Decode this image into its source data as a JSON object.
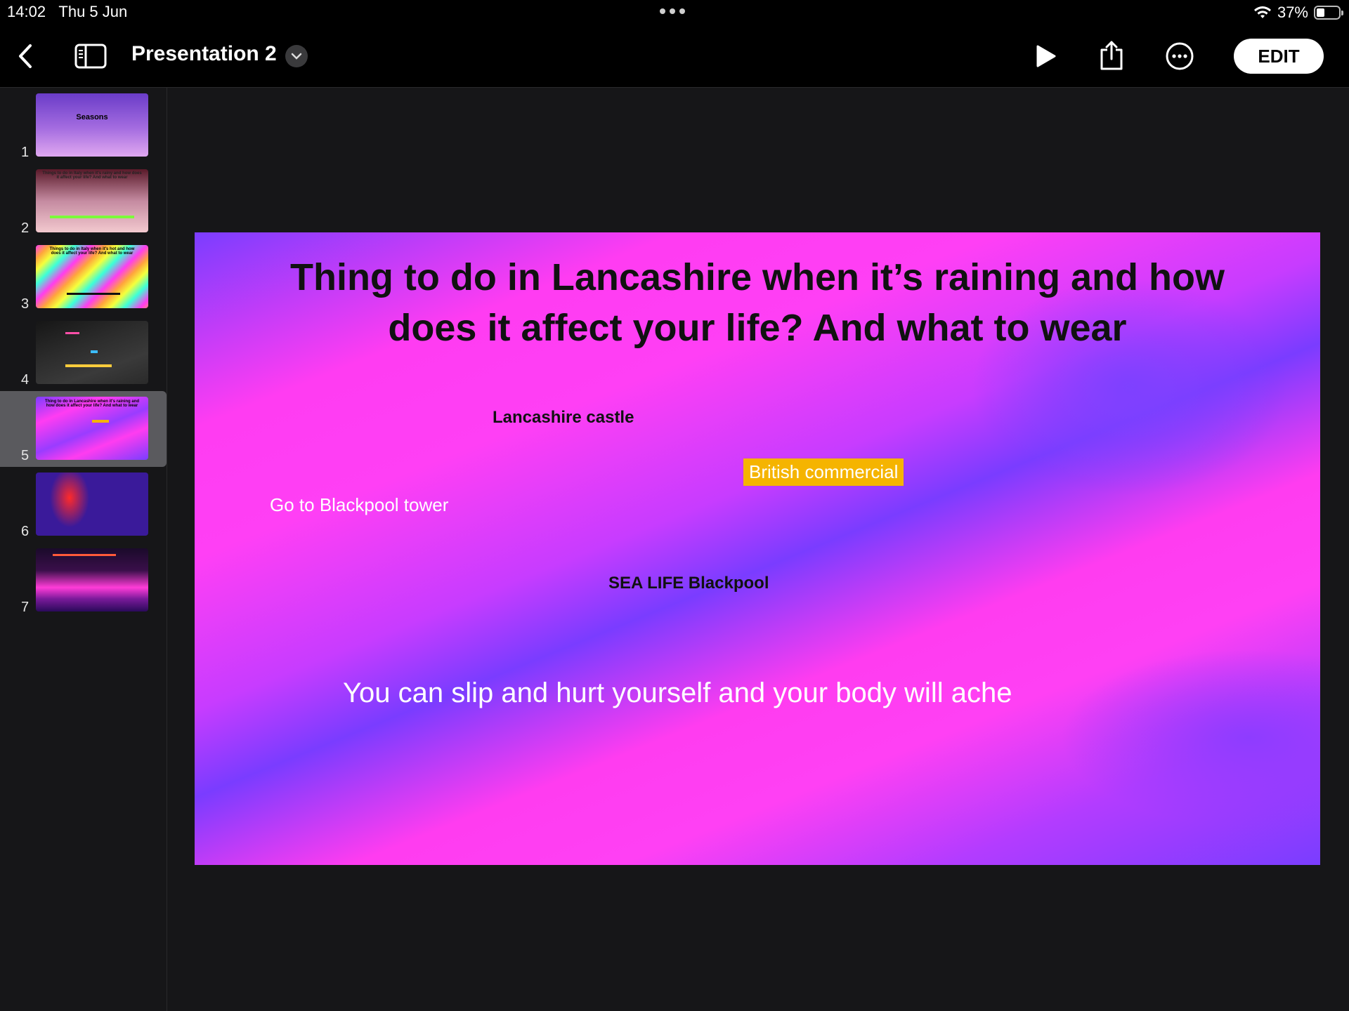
{
  "status_bar": {
    "time": "14:02",
    "date": "Thu 5 Jun",
    "battery": "37%",
    "battery_level": 0.37
  },
  "toolbar": {
    "title": "Presentation 2",
    "edit_label": "EDIT"
  },
  "icons": {
    "back": "chevron-left-icon",
    "sidebar": "sidebar-icon",
    "play": "play-icon",
    "share": "share-icon",
    "more": "more-icon"
  },
  "thumbnails": [
    {
      "num": "1",
      "caption": "Seasons"
    },
    {
      "num": "2",
      "caption": "Things to do in Italy when it's rainy and how does it affect your life? And what to wear"
    },
    {
      "num": "3",
      "caption": "Things to do in Italy when it's hot and how does it affect your life? And what to wear"
    },
    {
      "num": "4",
      "caption": ""
    },
    {
      "num": "5",
      "caption": "Thing to do in Lancashire when it's raining and how does it affect your life? And what to wear"
    },
    {
      "num": "6",
      "caption": ""
    },
    {
      "num": "7",
      "caption": ""
    }
  ],
  "slide": {
    "title": "Thing to do in  Lancashire when it’s raining and how does it affect your life? And what to wear",
    "lancashire": "Lancashire castle",
    "british": "British commercial",
    "blackpool_tower": "Go to Blackpool tower",
    "sea_life": "SEA LIFE Blackpool",
    "slip": "You can slip and hurt  yourself and your body will ache"
  },
  "colors": {
    "accent_yellow": "#f5b400",
    "magenta": "#ff3cf2",
    "violet": "#7a3cff"
  }
}
